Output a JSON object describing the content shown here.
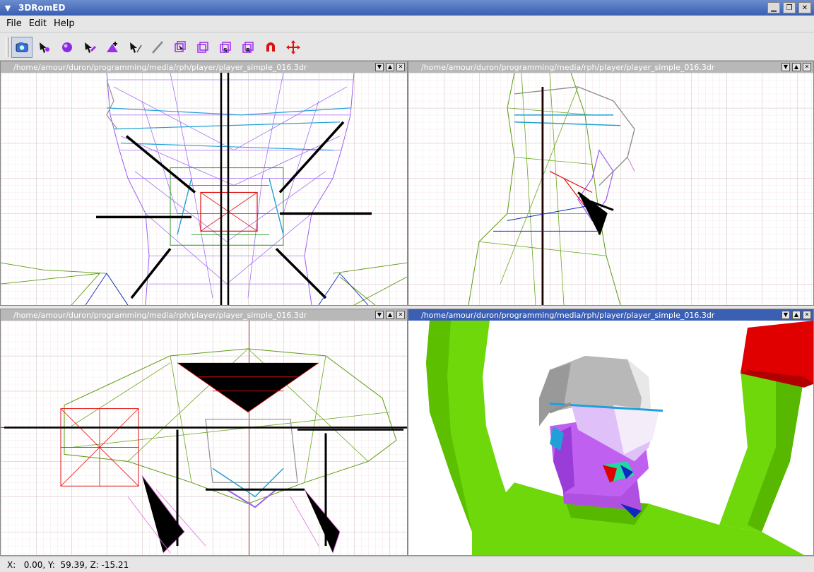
{
  "window": {
    "title": "3DRomED"
  },
  "menu": {
    "file": "File",
    "edit": "Edit",
    "help": "Help"
  },
  "toolbar": {
    "tools": [
      "camera-tool",
      "select-vertex-tool",
      "select-sphere-tool",
      "select-edge-tool",
      "add-vertex-tool",
      "select-arrow-tool",
      "draw-line-tool",
      "select-box-tool",
      "box-tool",
      "scale-box-tool",
      "rotate-box-tool",
      "magnet-tool",
      "move-tool"
    ],
    "scale_letter": "S",
    "rotate_letter": "R"
  },
  "panes": [
    {
      "title": "/home/amour/duron/programming/media/rph/player/player_simple_016.3dr",
      "view": "front-wireframe"
    },
    {
      "title": "/home/amour/duron/programming/media/rph/player/player_simple_016.3dr",
      "view": "side-wireframe"
    },
    {
      "title": "/home/amour/duron/programming/media/rph/player/player_simple_016.3dr",
      "view": "top-wireframe"
    },
    {
      "title": "/home/amour/duron/programming/media/rph/player/player_simple_016.3dr",
      "view": "perspective-shaded"
    }
  ],
  "status": {
    "text": "X:   0.00, Y:  59.39, Z: -15.21"
  },
  "colors": {
    "purple": "#9b5cf0",
    "green": "#5a9a10",
    "red": "#e01010",
    "cyan": "#20a0d8",
    "gray": "#909090",
    "pink": "#e070e0",
    "black": "#000000",
    "shaded_green": "#6ed80a",
    "shaded_red": "#e00000",
    "shaded_face": "#c060f0",
    "shaded_hair": "#b8b8b8"
  }
}
